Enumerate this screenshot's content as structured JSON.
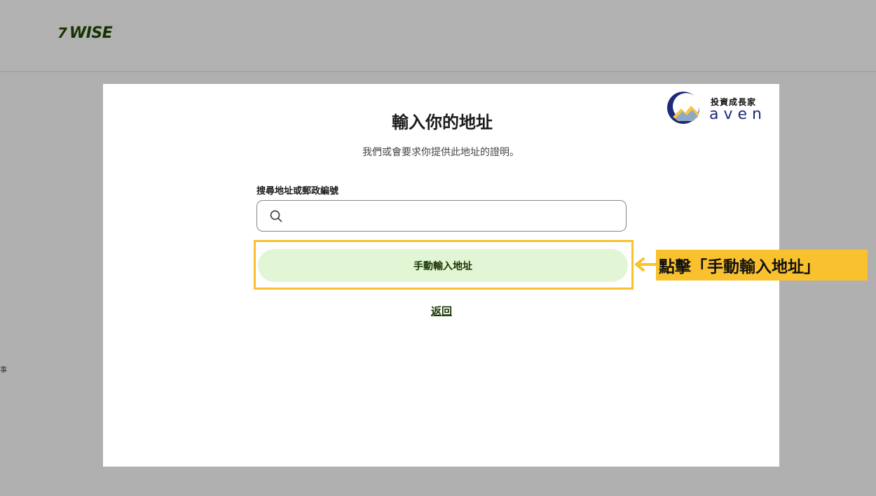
{
  "header": {
    "logo_mark": "7",
    "logo_text": "WISE"
  },
  "side_glyph": "事",
  "modal": {
    "title": "輸入你的地址",
    "subtitle": "我們或會要求你提供此地址的證明。",
    "search": {
      "label": "搜尋地址或郵政編號",
      "value": "",
      "placeholder": ""
    },
    "manual_button_label": "手動輸入地址",
    "back_link_label": "返回"
  },
  "annotation": {
    "text": "點擊「手動輸入地址」"
  },
  "watermark": {
    "top_text": "投資成長家",
    "bottom_text": "aven"
  },
  "colors": {
    "overlay": "#b0b0b0",
    "brand_dark_green": "#163300",
    "button_light_green": "#e2f6d5",
    "highlight_yellow": "#f9c12e",
    "watermark_blue": "#1e2a7a"
  },
  "icons": {
    "search": "search-icon",
    "arrow": "arrow-left-icon"
  }
}
